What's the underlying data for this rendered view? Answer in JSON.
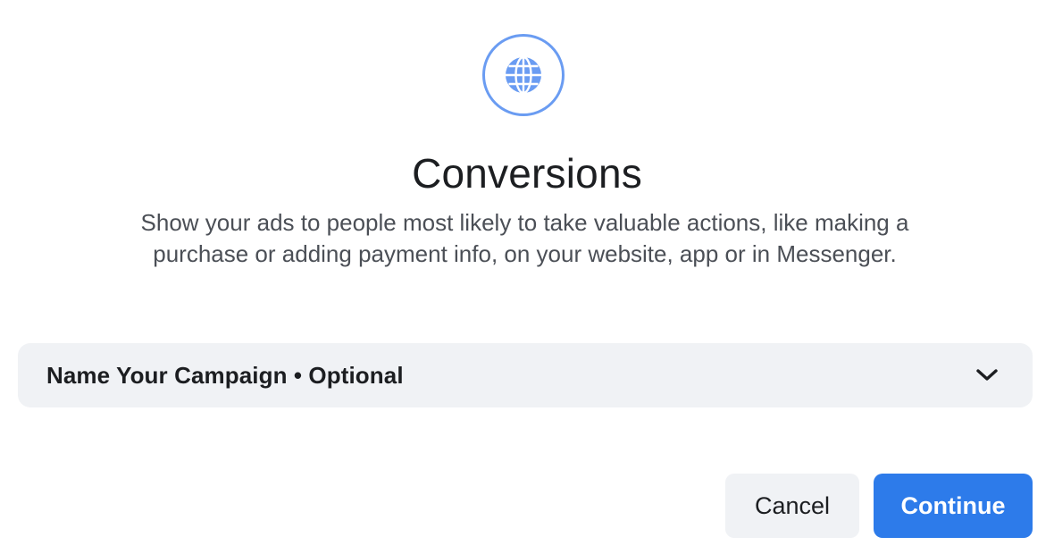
{
  "objective": {
    "icon": "globe-icon",
    "accent_color": "#6a9cf2",
    "title": "Conversions",
    "description": "Show your ads to people most likely to take valuable actions, like making a purchase or adding payment info, on your website, app or in Messenger."
  },
  "campaign_name": {
    "label": "Name Your Campaign • Optional",
    "icon": "chevron-down-icon"
  },
  "actions": {
    "cancel_label": "Cancel",
    "continue_label": "Continue",
    "primary_color": "#2d7bea"
  }
}
